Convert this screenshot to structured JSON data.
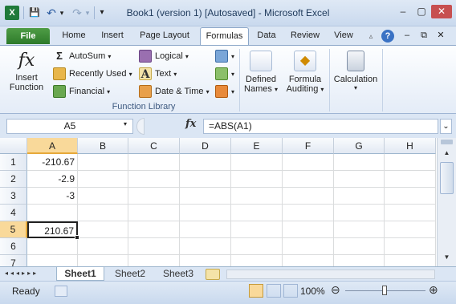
{
  "window": {
    "title": "Book1 (version 1) [Autosaved] - Microsoft Excel",
    "min": "–",
    "restore": "▢",
    "close": "✕",
    "doc_min": "–",
    "doc_restore": "⧉",
    "doc_close": "✕"
  },
  "qat": {
    "app_icon": "X",
    "save": "💾",
    "undo": "↶",
    "redo": "↷",
    "customize": "▾"
  },
  "tabs": [
    "File",
    "Home",
    "Insert",
    "Page Layout",
    "Formulas",
    "Data",
    "Review",
    "View"
  ],
  "ribbon": {
    "insert_function": {
      "icon": "fx",
      "line1": "Insert",
      "line2": "Function"
    },
    "autosum": "AutoSum",
    "recently_used": "Recently Used",
    "financial": "Financial",
    "logical": "Logical",
    "text": "Text",
    "date_time": "Date & Time",
    "defined_names": {
      "line1": "Defined",
      "line2": "Names"
    },
    "formula_auditing": {
      "line1": "Formula",
      "line2": "Auditing"
    },
    "calculation": "Calculation",
    "group_label": "Function Library",
    "dropdown_arrow": "▾",
    "sigma": "Σ",
    "text_icon": "A"
  },
  "formula_bar": {
    "name_box": "A5",
    "fx": "fx",
    "formula": "=ABS(A1)",
    "expand": "⌄"
  },
  "grid": {
    "columns": [
      "A",
      "B",
      "C",
      "D",
      "E",
      "F",
      "G",
      "H"
    ],
    "rows": [
      "1",
      "2",
      "3",
      "4",
      "5",
      "6",
      "7"
    ],
    "cells": [
      {
        "row": "1",
        "col": "A",
        "value": "-210.67"
      },
      {
        "row": "2",
        "col": "A",
        "value": "-2.9"
      },
      {
        "row": "3",
        "col": "A",
        "value": "-3"
      },
      {
        "row": "5",
        "col": "A",
        "value": "210.67"
      }
    ],
    "active_cell": "A5"
  },
  "sheets": [
    "Sheet1",
    "Sheet2",
    "Sheet3"
  ],
  "active_sheet": "Sheet1",
  "status": {
    "ready": "Ready",
    "zoom": "100%",
    "minus": "⊖",
    "plus": "⊕"
  },
  "colors": {
    "accent": "#2d7a2a",
    "active_header": "#f9d99a"
  }
}
